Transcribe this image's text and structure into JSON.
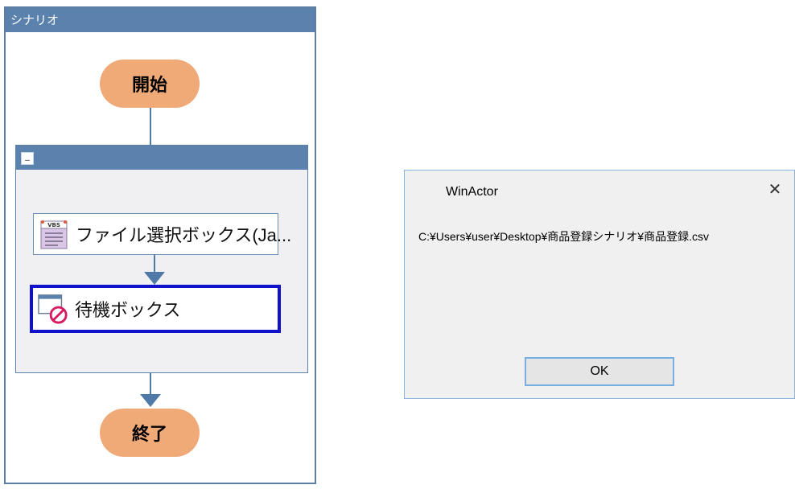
{
  "scenario": {
    "title": "シナリオ",
    "start_label": "開始",
    "end_label": "終了",
    "group": {
      "collapse_label": "_"
    },
    "nodes": [
      {
        "label": "ファイル選択ボックス(Ja...",
        "icon": "vbs-script-icon",
        "icon_text": "VBS"
      },
      {
        "label": "待機ボックス",
        "icon": "wait-box-icon",
        "selected": true
      }
    ]
  },
  "dialog": {
    "title": "WinActor",
    "close_glyph": "✕",
    "message": "C:¥Users¥user¥Desktop¥商品登録シナリオ¥商品登録.csv",
    "ok_label": "OK"
  },
  "colors": {
    "header_blue": "#5b81ad",
    "pill_orange": "#f0aa78",
    "selection_blue": "#1111cc",
    "prohibit_red": "#d81b60"
  }
}
